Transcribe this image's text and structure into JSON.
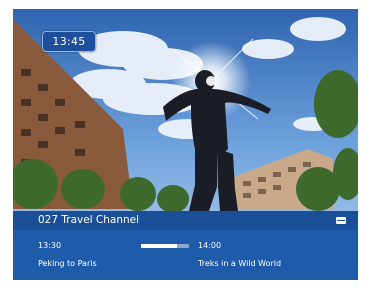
{
  "clock": {
    "time": "13:45"
  },
  "info_bar": {
    "channel": "027 Travel Channel",
    "current": {
      "start": "13:30",
      "title": "Peking to Paris"
    },
    "next": {
      "start": "14:00",
      "title": "Treks in a Wild World"
    },
    "progress": 0.75
  },
  "icons": {
    "menu": "menu-icon"
  },
  "colors": {
    "bar_blue": "#1f5bab",
    "header_blue": "#1a4f98",
    "clock_blue": "#1d4f9c"
  }
}
